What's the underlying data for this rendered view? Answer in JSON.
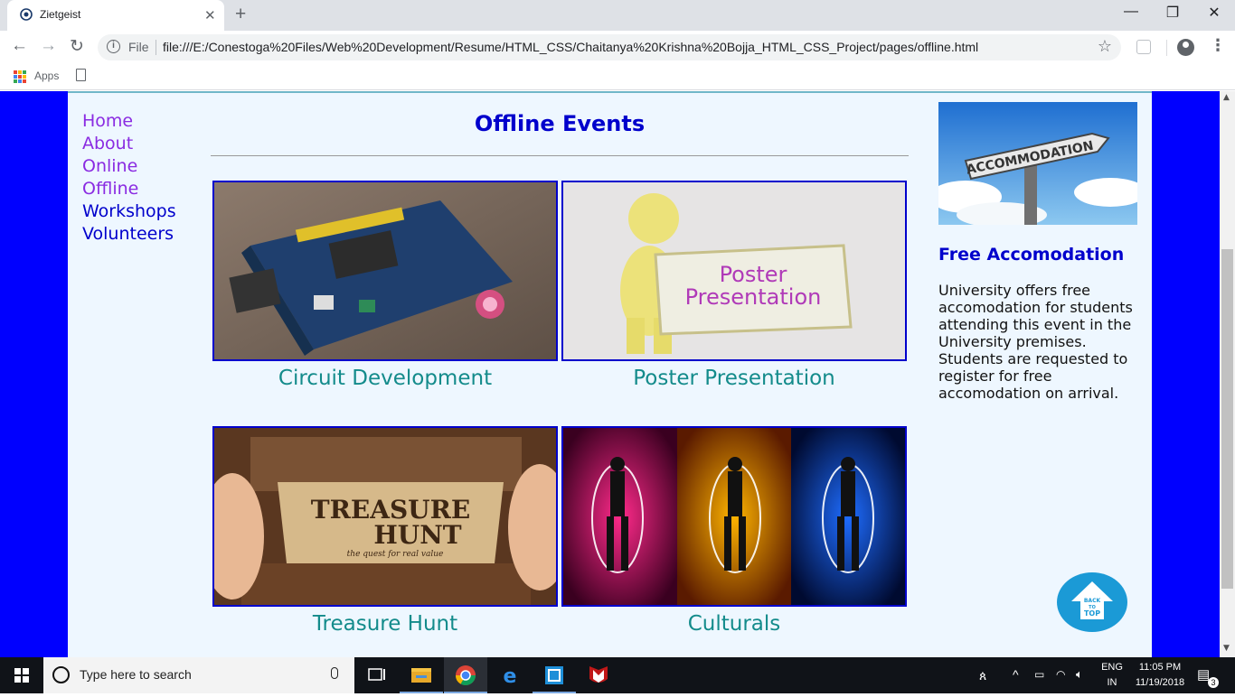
{
  "browser": {
    "tab_title": "Zietgeist",
    "tab_close": "✕",
    "new_tab": "+",
    "window_controls": {
      "minimize": "—",
      "restore": "❐",
      "close": "✕"
    },
    "nav": {
      "back": "←",
      "forward": "→",
      "reload": "↻"
    },
    "address": {
      "info": "i",
      "scheme_chip": "File",
      "url": "file:///E:/Conestoga%20Files/Web%20Development/Resume/HTML_CSS/Chaitanya%20Krishna%20Bojja_HTML_CSS_Project/pages/offline.html"
    },
    "star": "☆",
    "menu": "⋮",
    "bookmarks": {
      "apps_label": "Apps"
    }
  },
  "page": {
    "nav_links": [
      {
        "label": "Home",
        "visited": true
      },
      {
        "label": "About",
        "visited": true
      },
      {
        "label": "Online",
        "visited": true
      },
      {
        "label": "Offline",
        "visited": true
      },
      {
        "label": "Workshops",
        "visited": false
      },
      {
        "label": "Volunteers",
        "visited": false
      }
    ],
    "title": "Offline Events",
    "events": [
      {
        "label": "Circuit Development",
        "image_text": ""
      },
      {
        "label": "Poster Presentation",
        "image_text": [
          "Poster",
          "Presentation"
        ]
      },
      {
        "label": "Treasure Hunt",
        "image_text": [
          "TREASURE",
          "HUNT",
          "the quest for real value"
        ]
      },
      {
        "label": "Culturals",
        "image_text": ""
      }
    ],
    "aside": {
      "image_sign": "ACCOMMODATION",
      "title": "Free Accomodation",
      "text": "University offers free accomodation for students attending this event in the University premises. Students are requested to register for free accomodation on arrival."
    },
    "back_to_top": [
      "BACK",
      "TO",
      "TOP"
    ]
  },
  "taskbar": {
    "search_placeholder": "Type here to search",
    "language": [
      "ENG",
      "IN"
    ],
    "time": "11:05 PM",
    "date": "11/19/2018",
    "notification_count": "3"
  },
  "colors": {
    "page_bg_outer": "#0000ff",
    "page_bg_inner": "#eef7ff",
    "heading": "#0000cc",
    "link_visited": "#8a2be2",
    "link_unvisited": "#0000cc",
    "event_label": "#138b8b"
  }
}
